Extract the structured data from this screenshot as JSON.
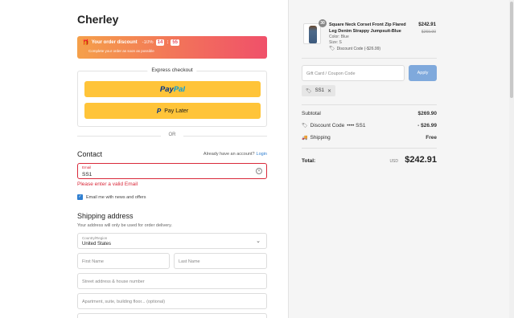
{
  "brand": "Cherley",
  "discount_banner": {
    "title": "Your order discount",
    "percent": "-10%",
    "timer": [
      "14",
      "55"
    ],
    "timer_sep": ":",
    "subtitle": "Complete your order as soon as possible"
  },
  "express": {
    "title": "Express checkout",
    "paypal_label": [
      "Pay",
      "Pal"
    ],
    "paylater_icon": "P",
    "paylater_label": "Pay Later"
  },
  "divider_or": "OR",
  "contact": {
    "heading": "Contact",
    "account_prompt": "Already have an account?",
    "login_link": "Login",
    "email_label": "Email",
    "email_value": "SS1",
    "error": "Please enter a valid Email",
    "newsletter_label": "Email me with news and offers",
    "newsletter_checked": true
  },
  "shipping": {
    "heading": "Shipping address",
    "subtext": "Your address will only be used for order delivery.",
    "country_label": "Country/Region",
    "country_value": "United States",
    "first_name_placeholder": "First Name",
    "last_name_placeholder": "Last Name",
    "street_placeholder": "Street address & house number",
    "apt_placeholder": "Apartment, suite, building floor... (optional)"
  },
  "product": {
    "quantity": "30",
    "title": "Square Neck Corset Front Zip Flared Leg Denim Strappy Jumpsuit-Blue",
    "color": "Color: Blue",
    "size": "Size: S",
    "discount": "Discount Code (-$26.99)",
    "price": "$242.91",
    "compare_price": "$269.90"
  },
  "coupon": {
    "placeholder": "Gift Card / Coupon Code",
    "apply_label": "Apply",
    "applied_code": "SS1"
  },
  "summary": {
    "subtotal_label": "Subtotal",
    "subtotal_value": "$269.90",
    "discount_label": "Discount Code",
    "discount_code": "•••• SS1",
    "discount_value": "- $26.99",
    "shipping_label": "Shipping",
    "shipping_value": "Free",
    "total_label": "Total:",
    "currency": "USD",
    "total_value": "$242.91"
  },
  "colors": {
    "accent": "#2f7fd1",
    "error": "#d9293a",
    "paypal_yellow": "#ffc439",
    "banner_start": "#f5a04a",
    "banner_end": "#f0506a",
    "apply_button": "#7fa9dc"
  },
  "icons": [
    "gift-icon",
    "clear-input-icon",
    "chevron-down-icon",
    "checkbox-icon",
    "tag-icon",
    "truck-icon",
    "close-icon"
  ]
}
